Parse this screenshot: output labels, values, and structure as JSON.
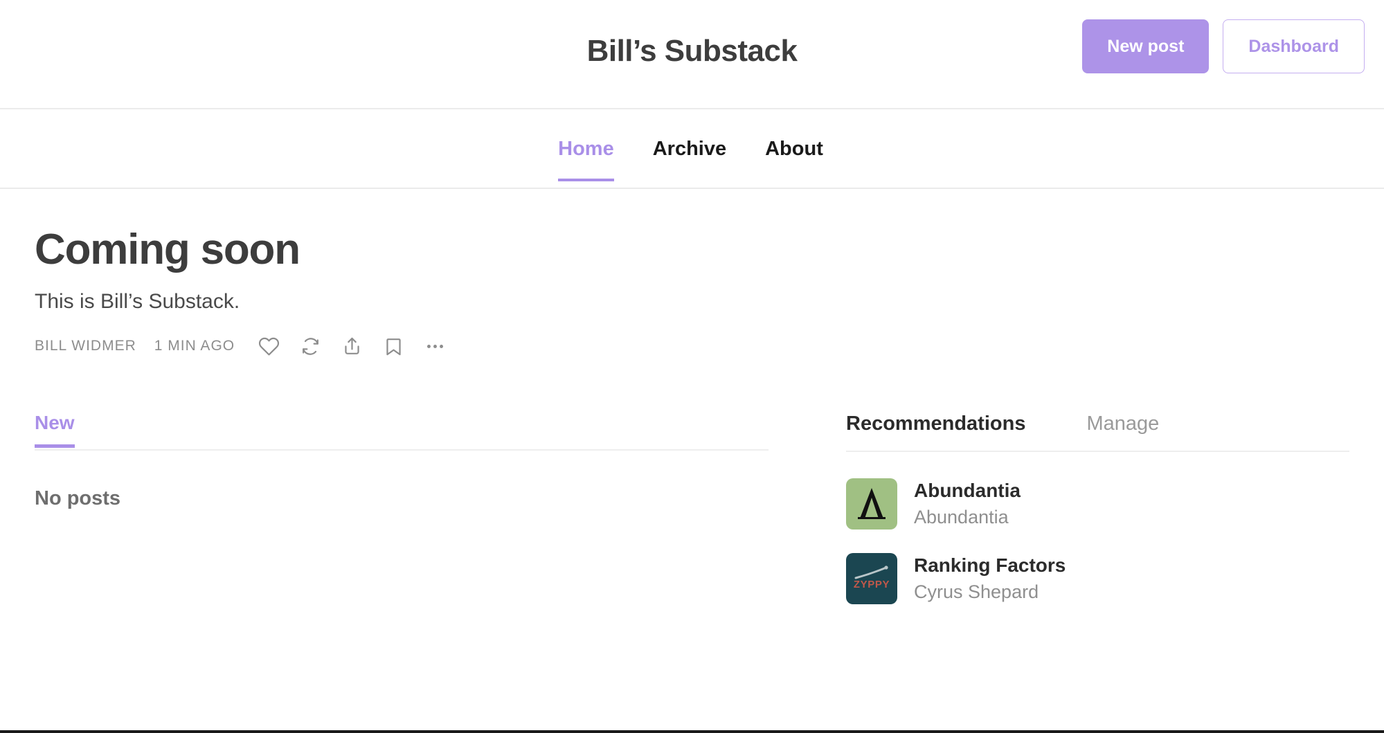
{
  "header": {
    "publication_title": "Bill’s Substack",
    "new_post_label": "New post",
    "dashboard_label": "Dashboard"
  },
  "nav": {
    "items": [
      {
        "label": "Home",
        "active": true
      },
      {
        "label": "Archive",
        "active": false
      },
      {
        "label": "About",
        "active": false
      }
    ]
  },
  "hero": {
    "title": "Coming soon",
    "subtitle": "This is Bill’s Substack.",
    "author": "BILL WIDMER",
    "timestamp": "1 MIN AGO",
    "icons": [
      "heart-icon",
      "restack-icon",
      "share-icon",
      "bookmark-icon",
      "ellipsis-icon"
    ]
  },
  "feed": {
    "tab_label": "New",
    "empty_message": "No posts"
  },
  "sidebar": {
    "title": "Recommendations",
    "manage_label": "Manage",
    "items": [
      {
        "name": "Abundantia",
        "author": "Abundantia",
        "avatar_bg": "#a0c083",
        "avatar_fg": "#111111",
        "avatar_glyph": "Λ"
      },
      {
        "name": "Ranking Factors",
        "author": "Cyrus Shepard",
        "avatar_bg": "#1b4651",
        "avatar_fg": "#c0584a",
        "avatar_glyph": "ZYPPY"
      }
    ]
  },
  "colors": {
    "accent": "#a98fe8",
    "primary_button": "#ad93e8",
    "text_dark": "#3d3d3d",
    "text_muted": "#8d8d8d",
    "divider": "#ebebeb"
  }
}
